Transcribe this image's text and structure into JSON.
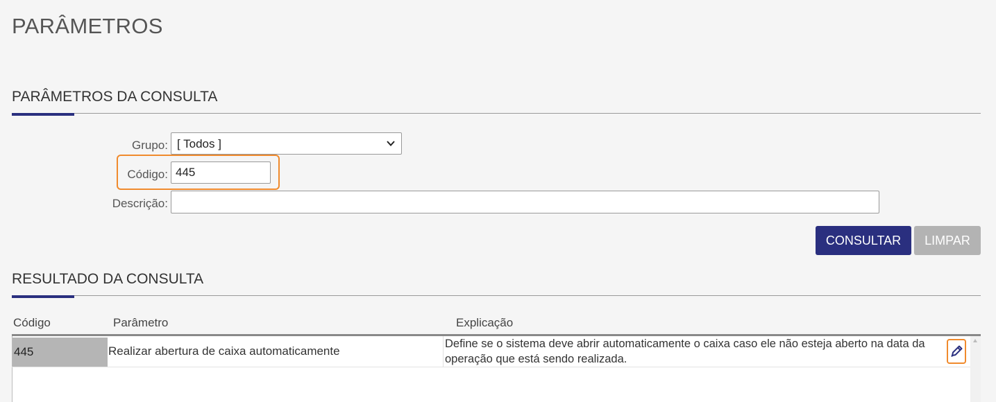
{
  "page": {
    "title": "PARÂMETROS"
  },
  "query_section": {
    "title": "PARÂMETROS DA CONSULTA",
    "grupo_label": "Grupo:",
    "grupo_value": "[ Todos ]",
    "codigo_label": "Código:",
    "codigo_value": "445",
    "descricao_label": "Descrição:",
    "descricao_value": "",
    "consultar_label": "CONSULTAR",
    "limpar_label": "LIMPAR"
  },
  "results_section": {
    "title": "RESULTADO DA CONSULTA",
    "columns": [
      "Código",
      "Parâmetro",
      "Explicação"
    ],
    "rows": [
      {
        "codigo": "445",
        "parametro": "Realizar abertura de caixa automaticamente",
        "explicacao": "Define se o sistema deve abrir automaticamente o caixa caso ele não esteja aberto na data da operação que está sendo realizada."
      }
    ]
  },
  "icons": {
    "select_arrow": "chevron-down-icon",
    "edit": "pencil-icon",
    "scroll_up": "scroll-up-arrow-icon"
  },
  "colors": {
    "accent": "#2a2f7f",
    "highlight": "#f08a2c",
    "secondary_button": "#b3b3b3"
  }
}
